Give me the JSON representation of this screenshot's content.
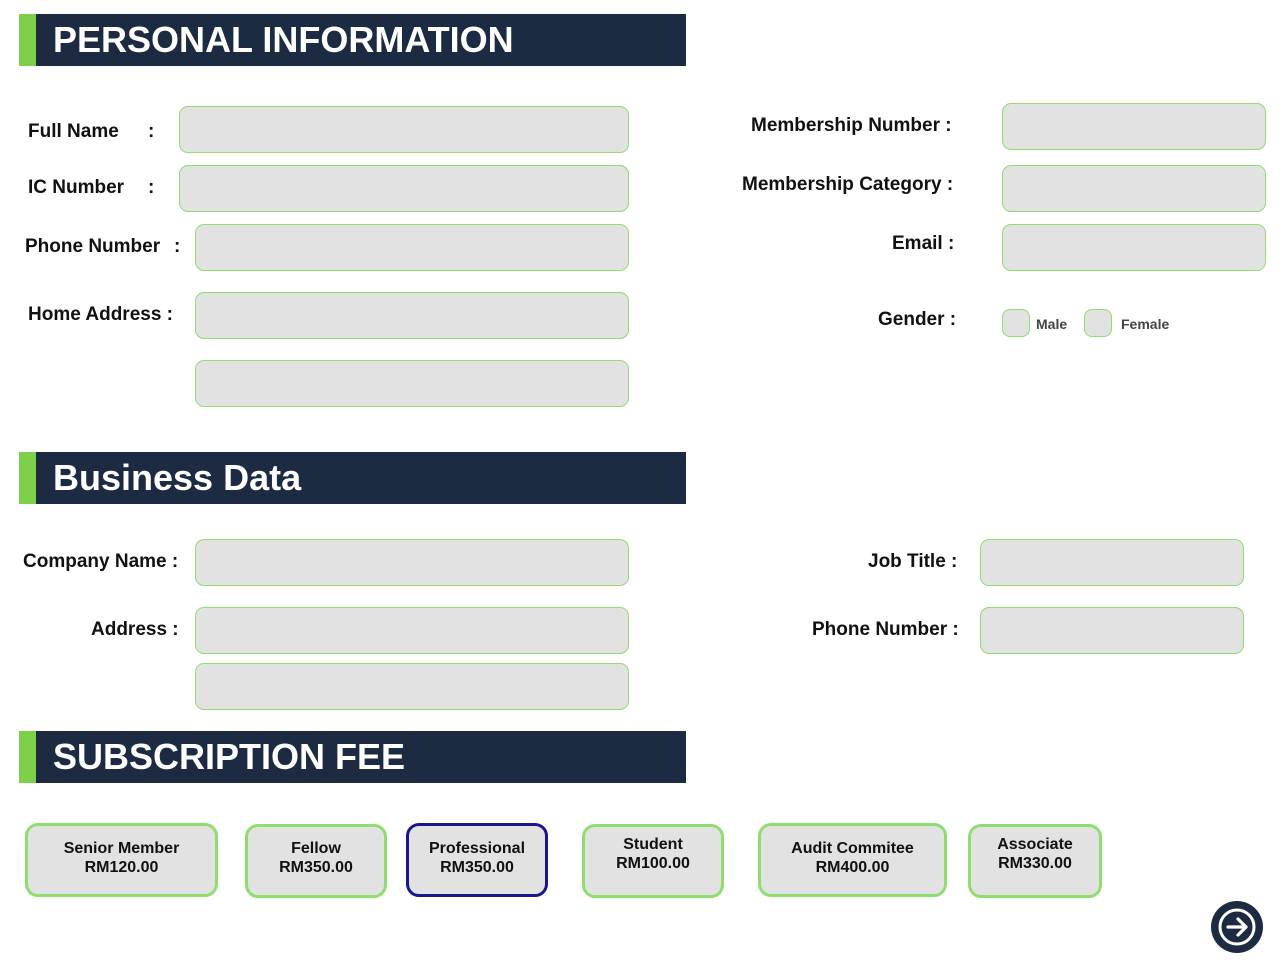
{
  "personal": {
    "header": "PERSONAL INFORMATION",
    "full_name_label": "Full Name",
    "ic_number_label": "IC Number",
    "phone_number_label": "Phone Number",
    "home_address_label": "Home Address :",
    "colon": ":",
    "membership_number_label": "Membership Number :",
    "membership_category_label": "Membership Category :",
    "email_label": "Email :",
    "gender_label": "Gender :",
    "gender_options": [
      "Male",
      "Female"
    ]
  },
  "business": {
    "header": "Business Data",
    "company_name_label": "Company Name :",
    "address_label": "Address :",
    "job_title_label": "Job Title :",
    "phone_number_label": "Phone Number :"
  },
  "subscription": {
    "header": "SUBSCRIPTION FEE",
    "selected": "Professional",
    "options": [
      {
        "name": "Senior Member",
        "price": "RM120.00"
      },
      {
        "name": "Fellow",
        "price": "RM350.00"
      },
      {
        "name": "Professional",
        "price": "RM350.00"
      },
      {
        "name": "Student",
        "price": "RM100.00"
      },
      {
        "name": "Audit Commitee",
        "price": "RM400.00"
      },
      {
        "name": "Associate",
        "price": "RM330.00"
      }
    ]
  },
  "navigation": {
    "next_icon": "arrow-right-circle-icon"
  },
  "colors": {
    "header_bg": "#1c2a42",
    "accent_green": "#7ed04b",
    "field_bg": "#e2e2e2",
    "field_border": "#8fdd6f",
    "selected_border": "#1a1690"
  }
}
